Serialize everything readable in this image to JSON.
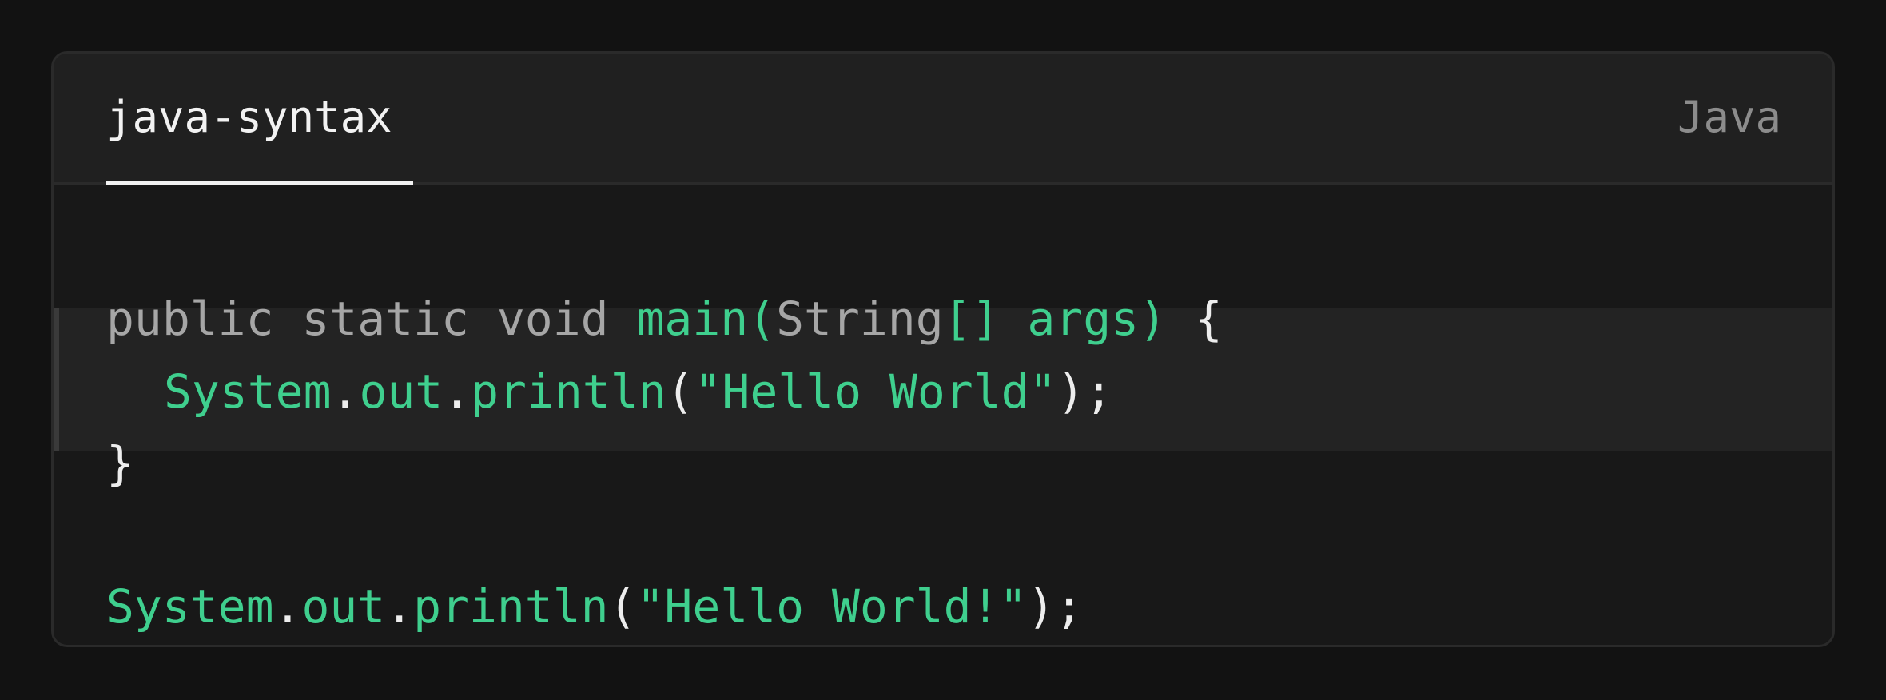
{
  "header": {
    "tab_label": "java-syntax",
    "language": "Java"
  },
  "code": {
    "line1": {
      "k1": "public",
      "k2": "static",
      "k3": "void",
      "main": "main(",
      "string": "String",
      "brackets": "[]",
      "args": "args)",
      "brace": "{"
    },
    "line2": {
      "system": "System",
      "dot1": ".",
      "out": "out",
      "dot2": ".",
      "println": "println",
      "lparen": "(",
      "string": "\"Hello World\"",
      "rparen": ");"
    },
    "line3": {
      "brace": "}"
    },
    "line4": {
      "system": "System",
      "dot1": ".",
      "out": "out",
      "dot2": ".",
      "println": "println",
      "lparen": "(",
      "string": "\"Hello World!\"",
      "rparen": ");"
    }
  },
  "colors": {
    "keyword": "#a6a6a6",
    "accent_green": "#3fcf8e",
    "punctuation": "#ededed",
    "background": "#181818"
  }
}
